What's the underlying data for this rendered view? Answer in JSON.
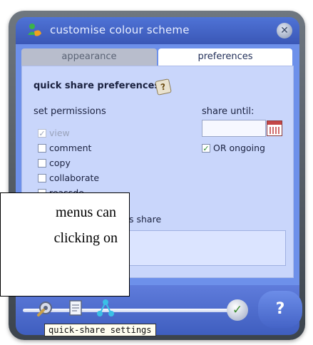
{
  "window": {
    "title": "customise colour scheme",
    "close_icon": "close-icon"
  },
  "tabs": [
    {
      "label": "appearance",
      "active": false
    },
    {
      "label": "preferences",
      "active": true
    }
  ],
  "preferences": {
    "heading": "quick share preferences",
    "help_icon": "help-icon",
    "set_permissions_label": "set permissions",
    "permissions": [
      {
        "label": "view",
        "checked": true,
        "disabled": true
      },
      {
        "label": "comment",
        "checked": false,
        "disabled": false
      },
      {
        "label": "copy",
        "checked": false,
        "disabled": false
      },
      {
        "label": "collaborate",
        "checked": false,
        "disabled": false
      },
      {
        "label": "reassde",
        "checked": false,
        "disabled": false
      }
    ],
    "share_until_label": "share until:",
    "share_until_value": "",
    "calendar_icon": "calendar-icon",
    "ongoing_label": "OR ongoing",
    "ongoing_checked": true,
    "notes_label_partial": "s share"
  },
  "bottom": {
    "tools": [
      "settings-wrench-icon",
      "document-icon",
      "network-icon"
    ],
    "confirm_icon": "checkmark-icon",
    "help_label": "?",
    "tooltip": "quick-share settings"
  },
  "callout": {
    "line1": "menus can",
    "line2": "clicking on"
  },
  "colors": {
    "titlebar": "#4f73d6",
    "panel": "#6d90ea",
    "content": "#c9d6fb",
    "check_green": "#2b8a2b"
  }
}
